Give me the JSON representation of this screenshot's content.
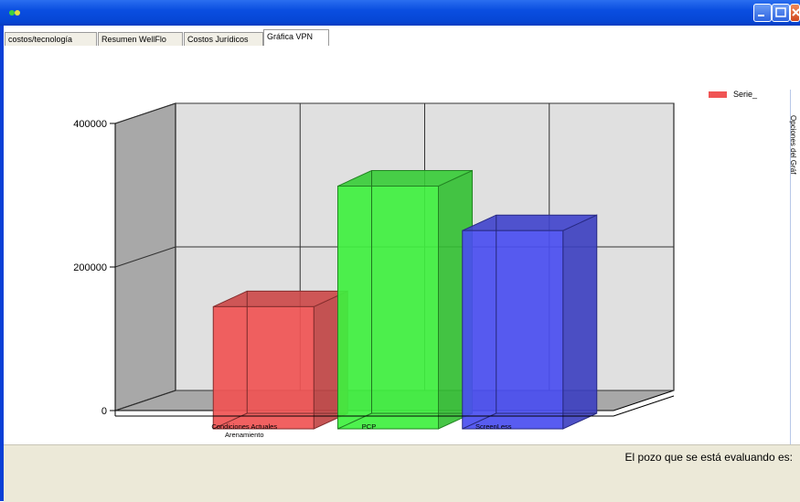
{
  "window": {
    "title": ""
  },
  "tabs": [
    {
      "label": "costos/tecnología"
    },
    {
      "label": "Resumen WellFlo"
    },
    {
      "label": "Costos Jurídicos"
    },
    {
      "label": "Gráfica VPN"
    }
  ],
  "legend": {
    "label": "Serie_"
  },
  "side_panel": {
    "label": "Opciones del Gráf"
  },
  "status": {
    "text": "El pozo que se está evaluando es:"
  },
  "chart_data": {
    "type": "bar",
    "categories": [
      "Condiciones Actuales Arenamiento",
      "PCP",
      "ScreenLess"
    ],
    "category_lines": [
      [
        "Condiciones Actuales",
        "Arenamiento"
      ],
      [
        "PCP"
      ],
      [
        "ScreenLess"
      ]
    ],
    "values": [
      160000,
      328000,
      266000
    ],
    "colors": [
      "#f05454",
      "#3ff03f",
      "#4a4ef0"
    ],
    "yticks": [
      0,
      200000,
      400000
    ],
    "ylim": [
      0,
      400000
    ],
    "grid": true,
    "legend_position": "top-right",
    "style": "3d"
  }
}
